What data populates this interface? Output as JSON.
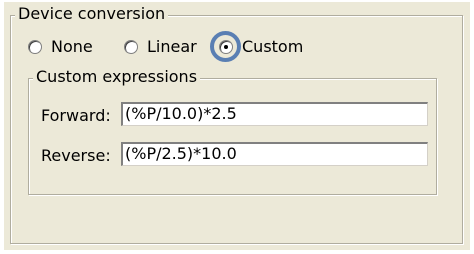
{
  "device_conversion": {
    "title": "Device conversion",
    "options": [
      {
        "label": "None",
        "selected": false
      },
      {
        "label": "Linear",
        "selected": false
      },
      {
        "label": "Custom",
        "selected": true
      }
    ]
  },
  "custom_expressions": {
    "title": "Custom expressions",
    "forward": {
      "label": "Forward:",
      "value": "(%P/10.0)*2.5"
    },
    "reverse": {
      "label": "Reverse:",
      "value": "(%P/2.5)*10.0"
    }
  },
  "colors": {
    "panel_background": "#ece9d8",
    "focus_ring": "#5a7fb3"
  }
}
